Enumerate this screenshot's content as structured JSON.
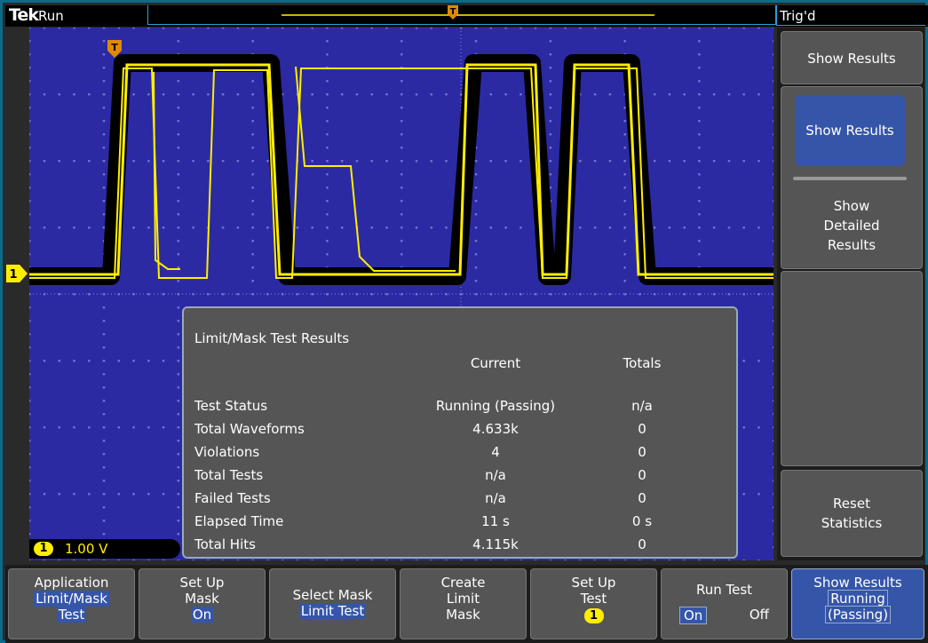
{
  "top_bar": {
    "brand": "Tek",
    "run_status": "Run",
    "trigger_state": "Trig'd"
  },
  "markers": {
    "trigger_position": "T",
    "channel": "1"
  },
  "scale_readout": {
    "channel": "1",
    "value": "1.00 V"
  },
  "results_panel": {
    "title": "Limit/Mask Test Results",
    "col_current": "Current",
    "col_totals": "Totals",
    "rows": [
      {
        "label": "Test Status",
        "current": "Running (Passing)",
        "totals": "n/a"
      },
      {
        "label": "Total Waveforms",
        "current": "4.633k",
        "totals": "0"
      },
      {
        "label": "Violations",
        "current": "4",
        "totals": "0"
      },
      {
        "label": "Total Tests",
        "current": "n/a",
        "totals": "0"
      },
      {
        "label": "Failed Tests",
        "current": "n/a",
        "totals": "0"
      },
      {
        "label": "Elapsed Time",
        "current": "11 s",
        "totals": "0 s"
      },
      {
        "label": "Total Hits",
        "current": "4.115k",
        "totals": "0"
      }
    ]
  },
  "side_menu": {
    "header": "Show Results",
    "active_option": "Show Results",
    "option2_line1": "Show",
    "option2_line2": "Detailed",
    "option2_line3": "Results",
    "reset_line1": "Reset",
    "reset_line2": "Statistics"
  },
  "bottom_menu": {
    "application": {
      "line1": "Application",
      "line2": "Limit/Mask",
      "line3": "Test"
    },
    "setup_mask": {
      "line1": "Set Up",
      "line2": "Mask",
      "line3": "On"
    },
    "select_mask": {
      "line1": "Select Mask",
      "line2": "Limit Test"
    },
    "create_limit_mask": {
      "line1": "Create",
      "line2": "Limit",
      "line3": "Mask"
    },
    "setup_test": {
      "line1": "Set Up",
      "line2": "Test",
      "line3": "1"
    },
    "run_test": {
      "line1": "Run Test",
      "on": "On",
      "off": "Off"
    },
    "show_results": {
      "line1": "Show Results",
      "line2": "Running",
      "line3": "(Passing)"
    }
  },
  "colors": {
    "screen_bg": "#2b2aa3",
    "trace": "#ffee00",
    "highlight": "#3555a8",
    "frame": "#0a6a8a"
  }
}
